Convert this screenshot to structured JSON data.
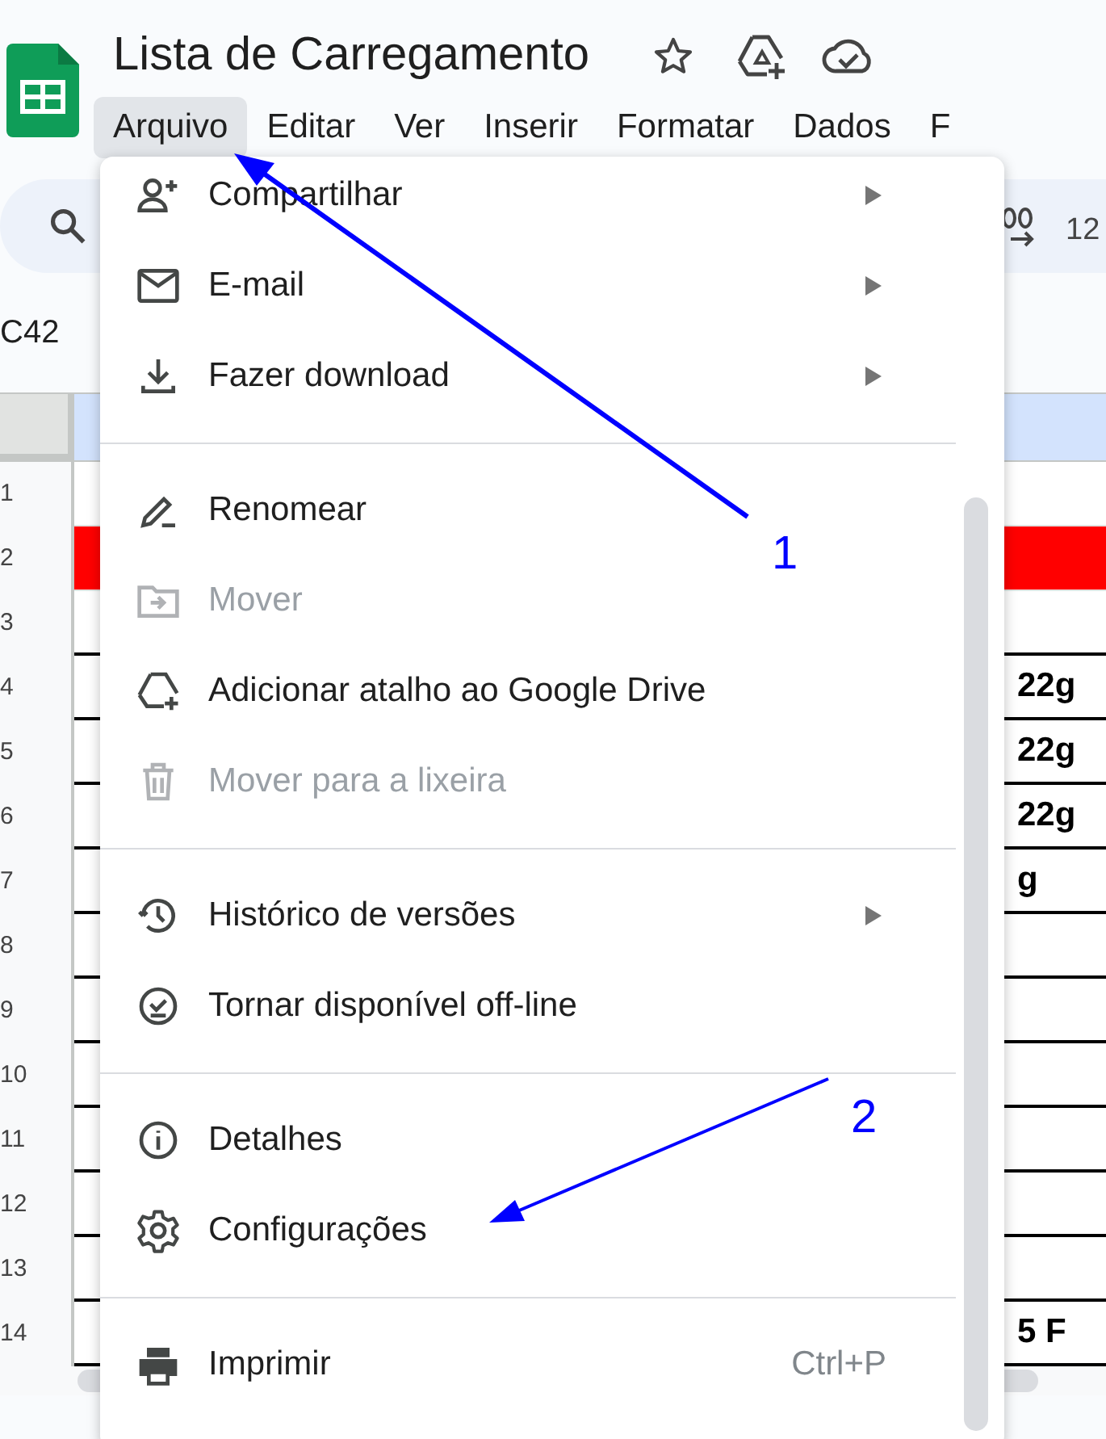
{
  "document": {
    "title": "Lista de Carregamento"
  },
  "menubar": [
    {
      "label": "Arquivo",
      "selected": true
    },
    {
      "label": "Editar",
      "selected": false
    },
    {
      "label": "Ver",
      "selected": false
    },
    {
      "label": "Inserir",
      "selected": false
    },
    {
      "label": "Formatar",
      "selected": false
    },
    {
      "label": "Dados",
      "selected": false
    },
    {
      "label": "F",
      "selected": false
    }
  ],
  "toolbar": {
    "format_text": "12"
  },
  "name_box": "C42",
  "grid": {
    "rows": [
      {
        "number": "1"
      },
      {
        "number": "2",
        "color": "#ff0000"
      },
      {
        "number": "3"
      },
      {
        "number": "4",
        "value": "22g"
      },
      {
        "number": "5",
        "value": "22g"
      },
      {
        "number": "6",
        "value": "22g"
      },
      {
        "number": "7",
        "value": "g"
      },
      {
        "number": "8"
      },
      {
        "number": "9"
      },
      {
        "number": "10"
      },
      {
        "number": "11"
      },
      {
        "number": "12"
      },
      {
        "number": "13"
      },
      {
        "number": "14",
        "value": "5 F"
      }
    ]
  },
  "file_menu": {
    "sections": [
      [
        {
          "label": "Compartilhar",
          "disabled": false,
          "submenu": true
        },
        {
          "label": "E-mail",
          "disabled": false,
          "submenu": true
        },
        {
          "label": "Fazer download",
          "disabled": false,
          "submenu": true
        }
      ],
      [
        {
          "label": "Renomear",
          "disabled": false,
          "submenu": false
        },
        {
          "label": "Mover",
          "disabled": true,
          "submenu": false
        },
        {
          "label": "Adicionar atalho ao Google Drive",
          "disabled": false,
          "submenu": false
        },
        {
          "label": "Mover para a lixeira",
          "disabled": true,
          "submenu": false
        }
      ],
      [
        {
          "label": "Histórico de versões",
          "disabled": false,
          "submenu": true
        },
        {
          "label": "Tornar disponível off-line",
          "disabled": false,
          "submenu": false
        }
      ],
      [
        {
          "label": "Detalhes",
          "disabled": false,
          "submenu": false
        },
        {
          "label": "Configurações",
          "disabled": false,
          "submenu": false
        }
      ],
      [
        {
          "label": "Imprimir",
          "disabled": false,
          "submenu": false,
          "shortcut": "Ctrl+P"
        }
      ]
    ]
  },
  "annotations": [
    {
      "label": "1"
    },
    {
      "label": "2"
    }
  ]
}
